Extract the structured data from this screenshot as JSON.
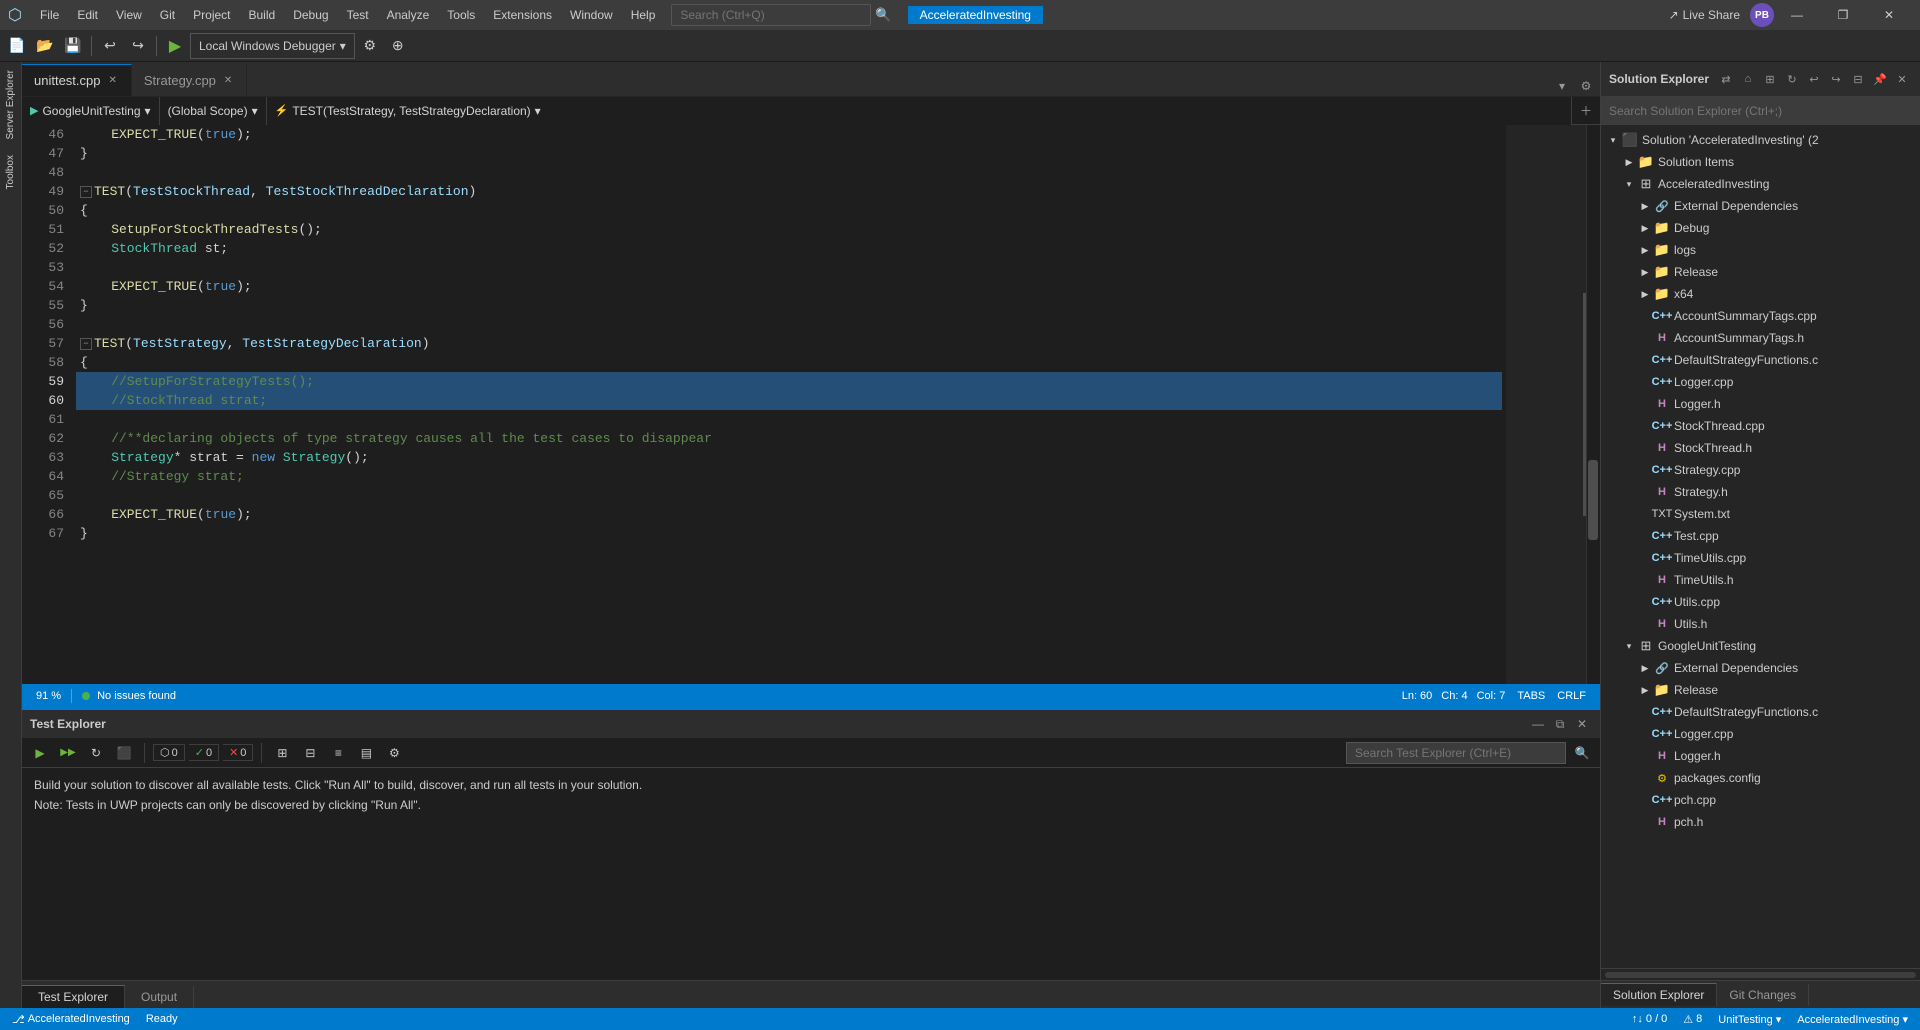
{
  "titleBar": {
    "logo": "⬡",
    "menus": [
      "File",
      "Edit",
      "View",
      "Git",
      "Project",
      "Build",
      "Debug",
      "Test",
      "Analyze",
      "Tools",
      "Extensions",
      "Window",
      "Help"
    ],
    "searchPlaceholder": "Search (Ctrl+Q)",
    "projectTitle": "AcceleratedInvesting",
    "liveShare": "Live Share",
    "winMinimize": "—",
    "winMaximize": "❐",
    "winClose": "✕"
  },
  "toolbar": {
    "debugConfig": "Local Windows Debugger",
    "dropdownArrow": "▾"
  },
  "tabs": [
    {
      "label": "unittest.cpp",
      "active": true,
      "modified": false
    },
    {
      "label": "Strategy.cpp",
      "active": false,
      "modified": false
    }
  ],
  "scopeBar": {
    "scope1": "GoogleUnitTesting",
    "scope2": "(Global Scope)",
    "scope3": "TEST(TestStrategy, TestStrategyDeclaration)"
  },
  "codeLines": [
    {
      "num": 46,
      "content": "    EXPECT_TRUE(true);",
      "highlight": false
    },
    {
      "num": 47,
      "content": "}",
      "highlight": false
    },
    {
      "num": 48,
      "content": "",
      "highlight": false
    },
    {
      "num": 49,
      "content": "TEST(TestStockThread, TestStockThreadDeclaration)",
      "highlight": false,
      "collapse": true
    },
    {
      "num": 50,
      "content": "{",
      "highlight": false
    },
    {
      "num": 51,
      "content": "    SetupForStockThreadTests();",
      "highlight": false
    },
    {
      "num": 52,
      "content": "    StockThread st;",
      "highlight": false
    },
    {
      "num": 53,
      "content": "",
      "highlight": false
    },
    {
      "num": 54,
      "content": "    EXPECT_TRUE(true);",
      "highlight": false
    },
    {
      "num": 55,
      "content": "}",
      "highlight": false
    },
    {
      "num": 56,
      "content": "",
      "highlight": false
    },
    {
      "num": 57,
      "content": "TEST(TestStrategy, TestStrategyDeclaration)",
      "highlight": false,
      "collapse": true
    },
    {
      "num": 58,
      "content": "{",
      "highlight": false
    },
    {
      "num": 59,
      "content": "    //SetupForStrategyTests();",
      "highlight": true
    },
    {
      "num": 60,
      "content": "    //StockThread strat;",
      "highlight": true,
      "current": true
    },
    {
      "num": 61,
      "content": "",
      "highlight": false
    },
    {
      "num": 62,
      "content": "    //**declaring objects of type strategy causes all the test cases to disappear",
      "highlight": false
    },
    {
      "num": 63,
      "content": "    Strategy* strat = new Strategy();",
      "highlight": false
    },
    {
      "num": 64,
      "content": "    //Strategy strat;",
      "highlight": false
    },
    {
      "num": 65,
      "content": "",
      "highlight": false
    },
    {
      "num": 66,
      "content": "    EXPECT_TRUE(true);",
      "highlight": false
    },
    {
      "num": 67,
      "content": "}",
      "highlight": false
    }
  ],
  "editorStatus": {
    "zoom": "91 %",
    "noIssues": "⚫ No issues found",
    "position": "Ln: 60",
    "char": "Ch: 4",
    "col": "Col: 7",
    "tabs": "TABS",
    "encoding": "CRLF"
  },
  "testExplorer": {
    "title": "Test Explorer",
    "counters": {
      "total": "0",
      "passed": "0",
      "failed": "0"
    },
    "searchPlaceholder": "Search Test Explorer (Ctrl+E)",
    "messages": [
      "Build your solution to discover all available tests. Click \"Run All\" to build, discover, and run all tests in your solution.",
      "",
      "Note: Tests in UWP projects can only be discovered by clicking \"Run All\"."
    ]
  },
  "panelTabs": [
    "Test Explorer",
    "Output"
  ],
  "solutionExplorer": {
    "title": "Solution Explorer",
    "searchPlaceholder": "Search Solution Explorer (Ctrl+;)",
    "tree": [
      {
        "level": 0,
        "label": "Solution 'AcceleratedInvesting' (2",
        "type": "solution",
        "expanded": true
      },
      {
        "level": 1,
        "label": "Solution Items",
        "type": "folder",
        "expanded": false
      },
      {
        "level": 1,
        "label": "AcceleratedInvesting",
        "type": "project",
        "expanded": true
      },
      {
        "level": 2,
        "label": "External Dependencies",
        "type": "ref",
        "expanded": false
      },
      {
        "level": 2,
        "label": "Debug",
        "type": "folder",
        "expanded": false
      },
      {
        "level": 2,
        "label": "logs",
        "type": "folder",
        "expanded": false
      },
      {
        "level": 2,
        "label": "Release",
        "type": "folder",
        "expanded": false
      },
      {
        "level": 2,
        "label": "x64",
        "type": "folder",
        "expanded": false
      },
      {
        "level": 2,
        "label": "AccountSummaryTags.cpp",
        "type": "cpp",
        "lock": true
      },
      {
        "level": 2,
        "label": "AccountSummaryTags.h",
        "type": "h",
        "lock": true
      },
      {
        "level": 2,
        "label": "DefaultStrategyFunctions.c",
        "type": "cpp",
        "lock": true
      },
      {
        "level": 2,
        "label": "Logger.cpp",
        "type": "cpp",
        "lock": true
      },
      {
        "level": 2,
        "label": "Logger.h",
        "type": "h",
        "lock": true
      },
      {
        "level": 2,
        "label": "StockThread.cpp",
        "type": "cpp",
        "lock": true
      },
      {
        "level": 2,
        "label": "StockThread.h",
        "type": "h",
        "lock": true
      },
      {
        "level": 2,
        "label": "Strategy.cpp",
        "type": "cpp",
        "lock": true
      },
      {
        "level": 2,
        "label": "Strategy.h",
        "type": "h",
        "lock": true
      },
      {
        "level": 2,
        "label": "System.txt",
        "type": "txt"
      },
      {
        "level": 2,
        "label": "Test.cpp",
        "type": "cpp",
        "lock": true
      },
      {
        "level": 2,
        "label": "TimeUtils.cpp",
        "type": "cpp"
      },
      {
        "level": 2,
        "label": "TimeUtils.h",
        "type": "h"
      },
      {
        "level": 2,
        "label": "Utils.cpp",
        "type": "cpp",
        "lock": true
      },
      {
        "level": 2,
        "label": "Utils.h",
        "type": "h",
        "lock": true
      },
      {
        "level": 1,
        "label": "GoogleUnitTesting",
        "type": "project",
        "expanded": true
      },
      {
        "level": 2,
        "label": "External Dependencies",
        "type": "ref",
        "expanded": false
      },
      {
        "level": 2,
        "label": "Release",
        "type": "folder",
        "expanded": false
      },
      {
        "level": 2,
        "label": "DefaultStrategyFunctions.c",
        "type": "cpp",
        "lock": true
      },
      {
        "level": 2,
        "label": "Logger.cpp",
        "type": "cpp",
        "lock": true
      },
      {
        "level": 2,
        "label": "Logger.h",
        "type": "h",
        "lock": true
      },
      {
        "level": 2,
        "label": "packages.config",
        "type": "config"
      },
      {
        "level": 2,
        "label": "pch.cpp",
        "type": "cpp"
      },
      {
        "level": 2,
        "label": "pch.h",
        "type": "h"
      }
    ],
    "bottomTabs": [
      "Solution Explorer",
      "Git Changes"
    ]
  },
  "statusBar": {
    "branch": "⎇ AcceleratedInvesting",
    "ready": "Ready",
    "errors": "↑↓ 0 / 0",
    "warnings": "⚠ 8",
    "config": "UnitTesting ▾",
    "project": "AcceleratedInvesting ▾"
  }
}
